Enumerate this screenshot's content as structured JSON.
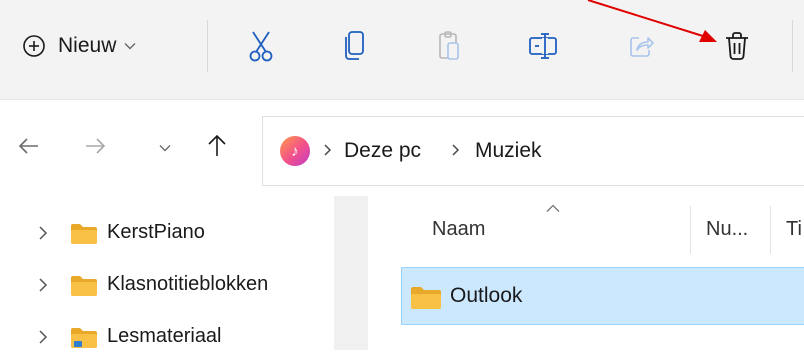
{
  "toolbar": {
    "new_label": "Nieuw",
    "new_icon": "plus-circle-icon",
    "cut_icon": "scissors-icon",
    "copy_icon": "copy-icon",
    "paste_icon": "clipboard-icon",
    "rename_icon": "rename-icon",
    "share_icon": "share-icon",
    "delete_icon": "trash-icon"
  },
  "annotation": {
    "color": "#e00000",
    "target": "delete-button"
  },
  "address": {
    "location_icon": "music-icon",
    "crumbs": [
      "Deze pc",
      "Muziek"
    ]
  },
  "navigation_pane": {
    "items": [
      {
        "label": "KerstPiano",
        "icon": "folder-icon"
      },
      {
        "label": "Klasnotitieblokken",
        "icon": "folder-icon"
      },
      {
        "label": "Lesmateriaal",
        "icon": "folder-icon"
      }
    ]
  },
  "file_list": {
    "columns": [
      "Naam",
      "Nu...",
      "Ti"
    ],
    "rows": [
      {
        "name": "Outlook",
        "icon": "folder-icon",
        "selected": true
      }
    ]
  },
  "colors": {
    "toolbar_bg": "#f3f3f3",
    "selection_bg": "#cce8ff",
    "selection_border": "#99d1ff",
    "folder": "#f8c146"
  }
}
